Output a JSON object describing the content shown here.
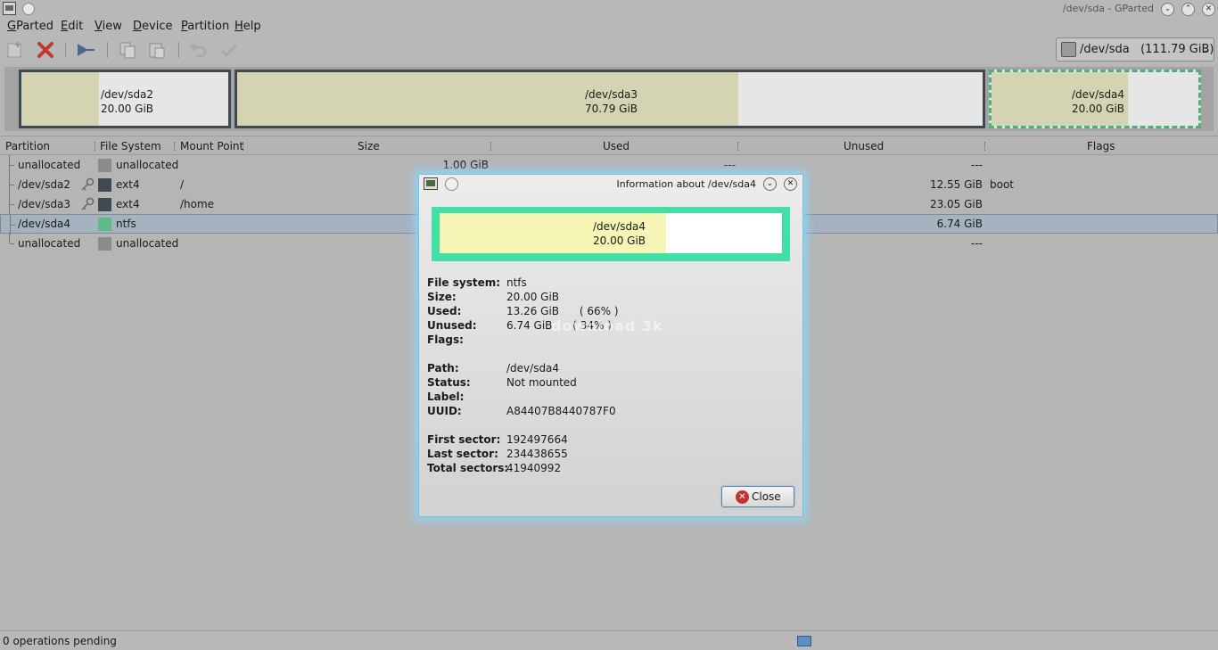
{
  "window": {
    "title": "/dev/sda - GParted"
  },
  "menu": [
    {
      "acc": "G",
      "rest": "Parted"
    },
    {
      "acc": "E",
      "rest": "dit"
    },
    {
      "acc": "V",
      "rest": "iew"
    },
    {
      "acc": "D",
      "rest": "evice"
    },
    {
      "acc": "P",
      "rest": "artition"
    },
    {
      "acc": "H",
      "rest": "elp"
    }
  ],
  "toolbar": {
    "device": "/dev/sda   (111.79 GiB)"
  },
  "partition_map": [
    {
      "name": "/dev/sda2",
      "size": "20.00 GiB",
      "used_fraction": 0.37
    },
    {
      "name": "/dev/sda3",
      "size": "70.79 GiB",
      "used_fraction": 0.67
    },
    {
      "name": "/dev/sda4",
      "size": "20.00 GiB",
      "used_fraction": 0.66
    }
  ],
  "columns": {
    "partition": "Partition",
    "filesystem": "File System",
    "mountpoint": "Mount Point",
    "size": "Size",
    "used": "Used",
    "unused": "Unused",
    "flags": "Flags"
  },
  "rows": [
    {
      "partition": "unallocated",
      "filesystem": "unallocated",
      "mountpoint": "",
      "size": "1.00 GiB",
      "used": "---",
      "unused": "---",
      "flags": "",
      "color": "#8c8c8c"
    },
    {
      "partition": "/dev/sda2",
      "filesystem": "ext4",
      "mountpoint": "/",
      "size": "",
      "used": "",
      "unused": "12.55 GiB",
      "flags": "boot",
      "color": "#3f4a54"
    },
    {
      "partition": "/dev/sda3",
      "filesystem": "ext4",
      "mountpoint": "/home",
      "size": "",
      "used": "",
      "unused": "23.05 GiB",
      "flags": "",
      "color": "#3f4a54"
    },
    {
      "partition": "/dev/sda4",
      "filesystem": "ntfs",
      "mountpoint": "",
      "size": "",
      "used": "",
      "unused": "6.74 GiB",
      "flags": "",
      "color": "#5fba8a"
    },
    {
      "partition": "unallocated",
      "filesystem": "unallocated",
      "mountpoint": "",
      "size": "",
      "used": "",
      "unused": "---",
      "flags": "",
      "color": "#8c8c8c"
    }
  ],
  "status": {
    "text": "0 operations pending"
  },
  "dialog": {
    "title": "Information about /dev/sda4",
    "map": {
      "name": "/dev/sda4",
      "size": "20.00 GiB",
      "used_fraction": 0.66
    },
    "fields": [
      {
        "k": "File system:",
        "v": "ntfs"
      },
      {
        "k": "Size:",
        "v": "20.00 GiB"
      },
      {
        "k": "Used:",
        "v": "13.26 GiB      ( 66% )"
      },
      {
        "k": "Unused:",
        "v": "6.74 GiB      ( 34% )"
      },
      {
        "k": "Flags:",
        "v": ""
      },
      {
        "k": "Path:",
        "v": "/dev/sda4"
      },
      {
        "k": "Status:",
        "v": "Not mounted"
      },
      {
        "k": "Label:",
        "v": ""
      },
      {
        "k": "UUID:",
        "v": "A84407B8440787F0"
      },
      {
        "k": "First sector:",
        "v": "192497664"
      },
      {
        "k": "Last sector:",
        "v": "234438655"
      },
      {
        "k": "Total sectors:",
        "v": "41940992"
      }
    ],
    "close_label": "Close",
    "watermark": "download 3k"
  },
  "colors": {
    "accent": "#42e0a4",
    "used": "#d4d3b2",
    "selection": "#a5b2bf"
  }
}
